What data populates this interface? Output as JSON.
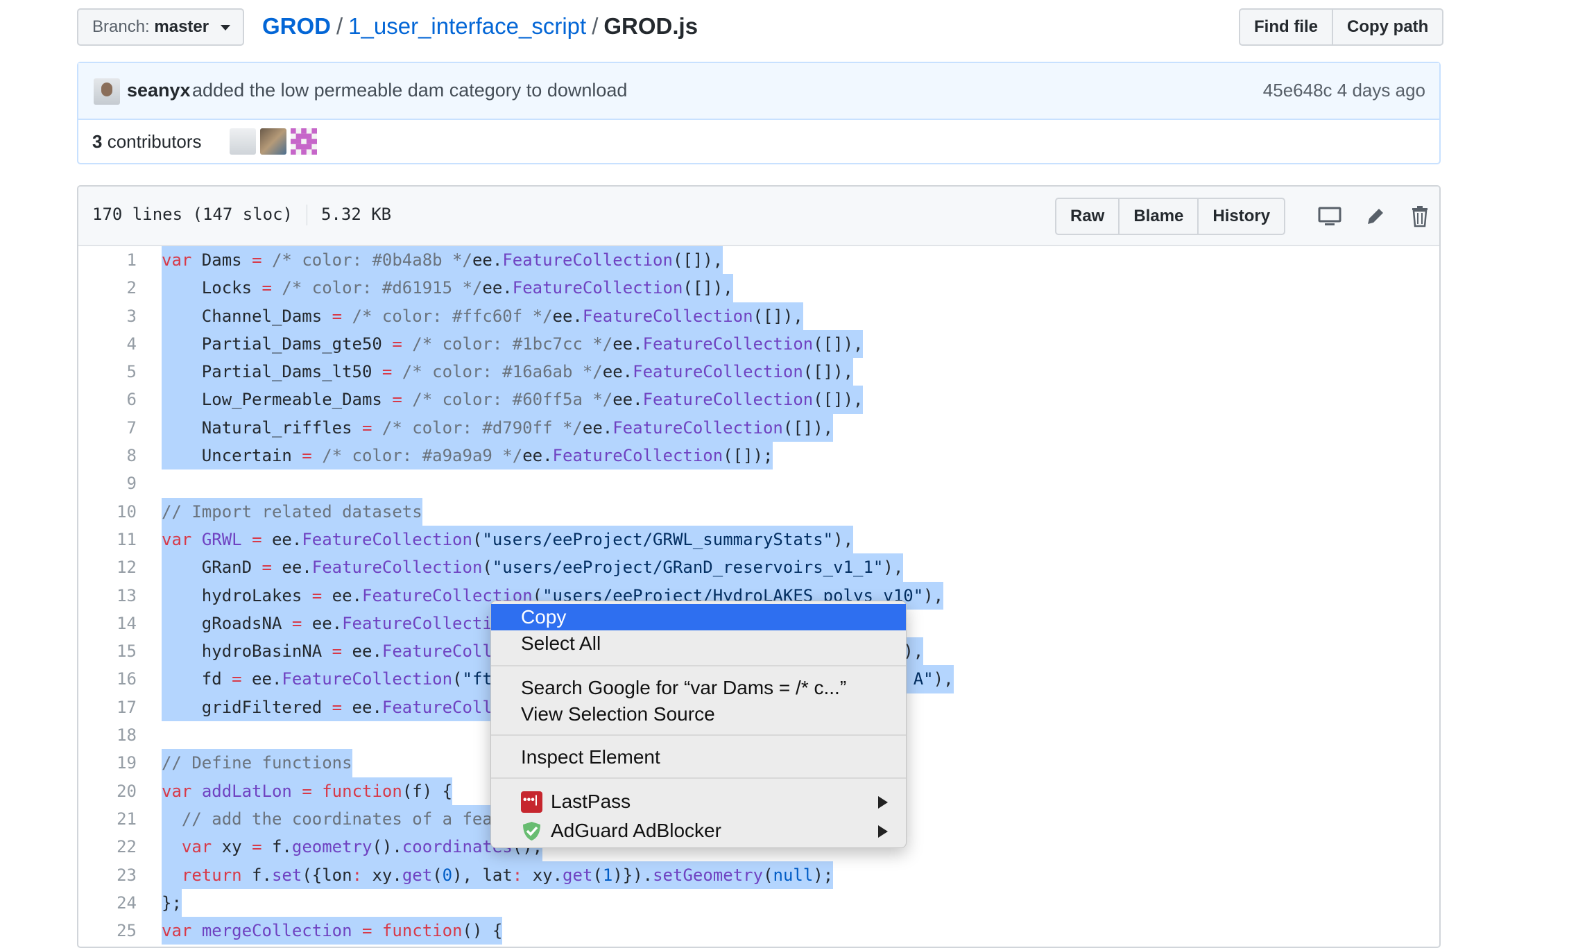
{
  "branch": {
    "label": "Branch:",
    "value": "master"
  },
  "breadcrumb": {
    "repo": "GROD",
    "folder": "1_user_interface_script",
    "file": "GROD.js",
    "sep": "/"
  },
  "header_buttons": {
    "find_file": "Find file",
    "copy_path": "Copy path"
  },
  "commit": {
    "author": "seanyx",
    "message": "added the low permeable dam category to download",
    "sha": "45e648c",
    "time": "4 days ago"
  },
  "contributors": {
    "count": "3",
    "label": "contributors"
  },
  "file": {
    "lines": "170 lines (147 sloc)",
    "size": "5.32 KB",
    "buttons": {
      "raw": "Raw",
      "blame": "Blame",
      "history": "History"
    },
    "icons": [
      "desktop-icon",
      "pencil-icon",
      "trash-icon"
    ]
  },
  "code_lines": [
    "1",
    "2",
    "3",
    "4",
    "5",
    "6",
    "7",
    "8",
    "9",
    "10",
    "11",
    "12",
    "13",
    "14",
    "15",
    "16",
    "17",
    "18",
    "19",
    "20",
    "21",
    "22",
    "23",
    "24",
    "25"
  ],
  "context_menu": {
    "copy": "Copy",
    "select_all": "Select All",
    "search_google": "Search Google for “var Dams = /* c...”",
    "view_source": "View Selection Source",
    "inspect": "Inspect Element",
    "lastpass": "LastPass",
    "adguard": "AdGuard AdBlocker"
  },
  "colors": {
    "link": "#0366d6",
    "selection": "#b4d5fe",
    "menu_highlight": "#2e6ff0"
  }
}
